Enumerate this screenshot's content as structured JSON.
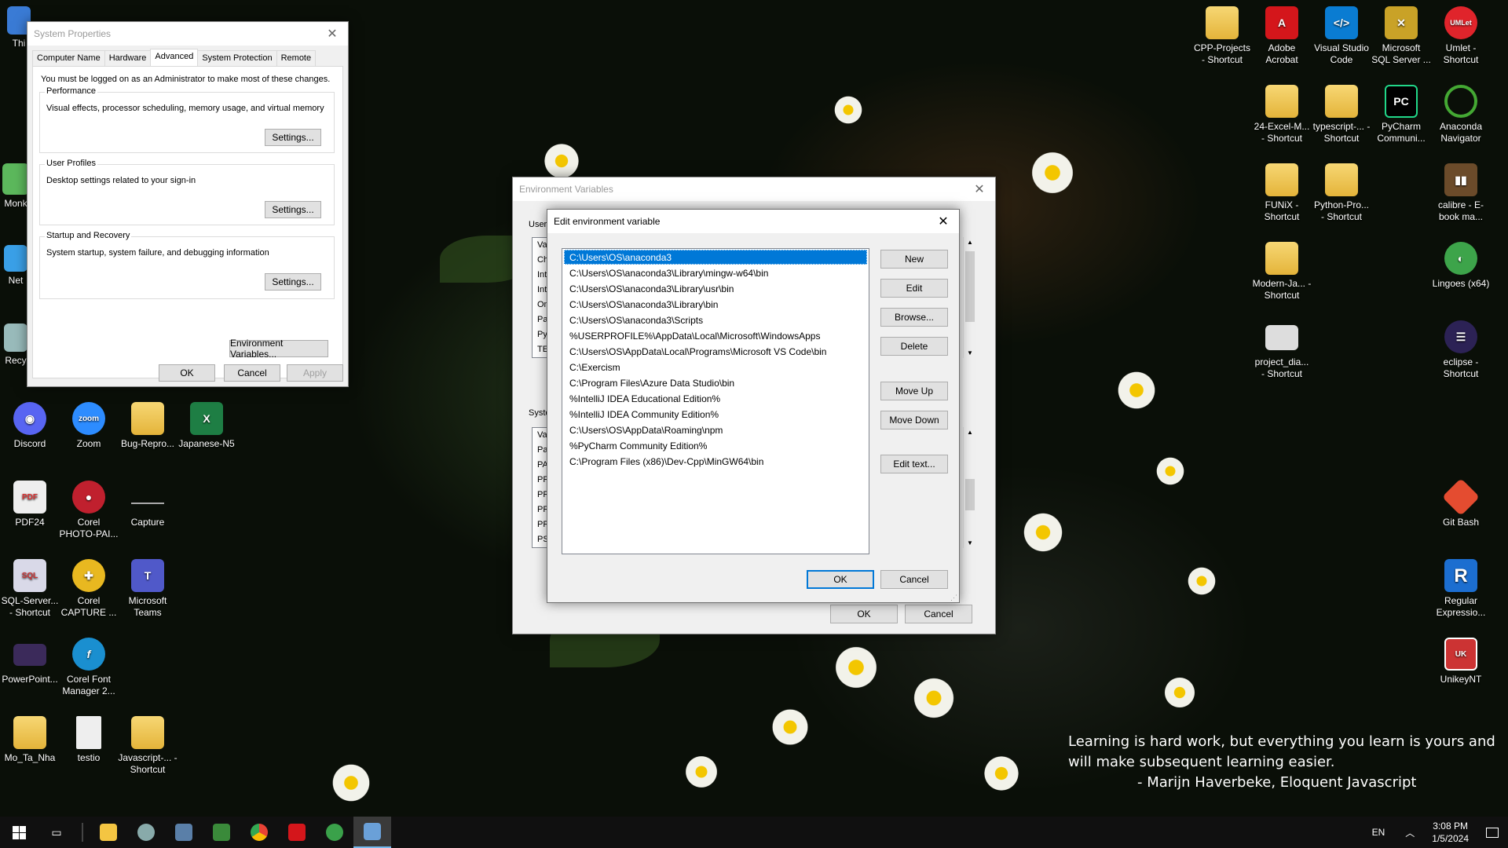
{
  "desktop": {
    "icons_left": [
      {
        "label": "Thi",
        "color": "#3a7bd5"
      },
      {
        "label": "Monk",
        "color": "#5cb85c"
      },
      {
        "label": "Net",
        "color": "#3aa0e8"
      },
      {
        "label": "Recy",
        "color": "#9bb"
      },
      {
        "label": "Discord",
        "color": "#5865f2"
      },
      {
        "label": "Zoom",
        "color": "#2d8cff"
      },
      {
        "label": "Bug-Repro...",
        "color": "#e4b43a"
      },
      {
        "label": "Japanese-N5",
        "color": "#1e7e44"
      },
      {
        "label": "PDF24",
        "color": "#d33"
      },
      {
        "label": "Corel PHOTO-PAI...",
        "color": "#c0202e"
      },
      {
        "label": "Capture",
        "color": "#333"
      },
      {
        "label": "SQL-Server... - Shortcut",
        "color": "#d9d9e8"
      },
      {
        "label": "Corel CAPTURE ...",
        "color": "#e8b820"
      },
      {
        "label": "Microsoft Teams",
        "color": "#5059c9"
      },
      {
        "label": "PowerPoint...",
        "color": "#3b2a5a"
      },
      {
        "label": "Corel Font Manager 2...",
        "color": "#1a8fd0"
      },
      {
        "label": "Mo_Ta_Nha",
        "color": "#e4b43a"
      },
      {
        "label": "testio",
        "color": "#eee"
      },
      {
        "label": "Javascript-... - Shortcut",
        "color": "#e4b43a"
      }
    ],
    "icons_right": [
      {
        "label": "CPP-Projects - Shortcut",
        "color": "#e4b43a"
      },
      {
        "label": "Adobe Acrobat",
        "color": "#d4161b"
      },
      {
        "label": "Visual Studio Code",
        "color": "#0a7cd2"
      },
      {
        "label": "Microsoft SQL Server ...",
        "color": "#c9a227"
      },
      {
        "label": "Umlet - Shortcut",
        "color": "#e0242b"
      },
      {
        "label": "24-Excel-M... - Shortcut",
        "color": "#e4b43a"
      },
      {
        "label": "typescript-... - Shortcut",
        "color": "#e4b43a"
      },
      {
        "label": "PyCharm Communi...",
        "color": "#21d789"
      },
      {
        "label": "Anaconda Navigator",
        "color": "#44a833"
      },
      {
        "label": "FUNiX - Shortcut",
        "color": "#e4b43a"
      },
      {
        "label": "Python-Pro... - Shortcut",
        "color": "#e4b43a"
      },
      {
        "label": "calibre - E-book ma...",
        "color": "#6b4b2a"
      },
      {
        "label": "Modern-Ja... - Shortcut",
        "color": "#e4b43a"
      },
      {
        "label": "Lingoes (x64)",
        "color": "#3da44a"
      },
      {
        "label": "project_dia... - Shortcut",
        "color": "#ddd"
      },
      {
        "label": "eclipse - Shortcut",
        "color": "#2c2255"
      },
      {
        "label": "Git Bash",
        "color": "#e44c30"
      },
      {
        "label": "Regular Expressio...",
        "color": "#1c6ed0"
      },
      {
        "label": "UnikeyNT",
        "color": "#c33"
      }
    ],
    "quote": {
      "line1": "Learning is hard work, but everything you learn is yours and",
      "line2": "will make subsequent learning easier.",
      "author": "- Marijn Haverbeke, Eloquent Javascript"
    }
  },
  "system_properties": {
    "title": "System Properties",
    "tabs": [
      "Computer Name",
      "Hardware",
      "Advanced",
      "System Protection",
      "Remote"
    ],
    "admin_note": "You must be logged on as an Administrator to make most of these changes.",
    "performance": {
      "label": "Performance",
      "desc": "Visual effects, processor scheduling, memory usage, and virtual memory",
      "button": "Settings..."
    },
    "user_profiles": {
      "label": "User Profiles",
      "desc": "Desktop settings related to your sign-in",
      "button": "Settings..."
    },
    "startup": {
      "label": "Startup and Recovery",
      "desc": "System startup, system failure, and debugging information",
      "button": "Settings..."
    },
    "env_button": "Environment Variables...",
    "ok": "OK",
    "cancel": "Cancel",
    "apply": "Apply"
  },
  "env_vars": {
    "title": "Environment Variables",
    "user_label": "User",
    "user_rows": [
      "Va",
      "Ch",
      "Int",
      "Int",
      "On",
      "Pa",
      "Py",
      "TE"
    ],
    "system_label": "Syste",
    "system_rows": [
      "Va",
      "Pa",
      "PA",
      "PR",
      "PR",
      "PR",
      "PR",
      "PS"
    ],
    "ok": "OK",
    "cancel": "Cancel"
  },
  "edit_env": {
    "title": "Edit environment variable",
    "entries": [
      "C:\\Users\\OS\\anaconda3",
      "C:\\Users\\OS\\anaconda3\\Library\\mingw-w64\\bin",
      "C:\\Users\\OS\\anaconda3\\Library\\usr\\bin",
      "C:\\Users\\OS\\anaconda3\\Library\\bin",
      "C:\\Users\\OS\\anaconda3\\Scripts",
      "%USERPROFILE%\\AppData\\Local\\Microsoft\\WindowsApps",
      "C:\\Users\\OS\\AppData\\Local\\Programs\\Microsoft VS Code\\bin",
      "C:\\Exercism",
      "C:\\Program Files\\Azure Data Studio\\bin",
      "%IntelliJ IDEA Educational Edition%",
      "%IntelliJ IDEA Community Edition%",
      "C:\\Users\\OS\\AppData\\Roaming\\npm",
      "%PyCharm Community Edition%",
      "C:\\Program Files (x86)\\Dev-Cpp\\MinGW64\\bin"
    ],
    "selected_index": 0,
    "buttons": {
      "new": "New",
      "edit": "Edit",
      "browse": "Browse...",
      "delete": "Delete",
      "move_up": "Move Up",
      "move_down": "Move Down",
      "edit_text": "Edit text...",
      "ok": "OK",
      "cancel": "Cancel"
    }
  },
  "taskbar": {
    "apps": [
      {
        "name": "file-explorer-icon",
        "color": "#f4c542"
      },
      {
        "name": "settings-app-icon",
        "color": "#8aa"
      },
      {
        "name": "calculator-icon",
        "color": "#5a7fa8"
      },
      {
        "name": "notepad-icon",
        "color": "#3a8a3a"
      },
      {
        "name": "chrome-icon",
        "color": "#e94235"
      },
      {
        "name": "acrobat-icon",
        "color": "#d4161b"
      },
      {
        "name": "network-app-icon",
        "color": "#3aa14a"
      },
      {
        "name": "system-properties-icon",
        "color": "#6aa0d8"
      }
    ],
    "lang": "EN",
    "time": "3:08 PM",
    "date": "1/5/2024"
  }
}
